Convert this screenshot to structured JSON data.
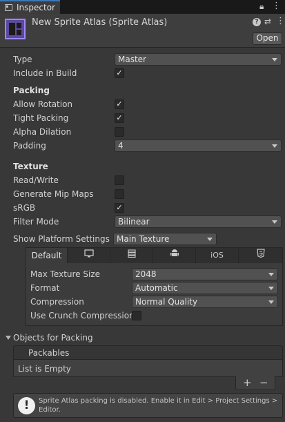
{
  "tab": {
    "title": "Inspector"
  },
  "header": {
    "title": "New Sprite Atlas (Sprite Atlas)",
    "open_label": "Open"
  },
  "type_row": {
    "label": "Type",
    "value": "Master"
  },
  "include_row": {
    "label": "Include in Build",
    "checked": true
  },
  "packing": {
    "heading": "Packing",
    "allow_rotation": {
      "label": "Allow Rotation",
      "checked": true
    },
    "tight_packing": {
      "label": "Tight Packing",
      "checked": true
    },
    "alpha_dilation": {
      "label": "Alpha Dilation",
      "checked": false
    },
    "padding": {
      "label": "Padding",
      "value": "4"
    }
  },
  "texture": {
    "heading": "Texture",
    "read_write": {
      "label": "Read/Write",
      "checked": false
    },
    "mip_maps": {
      "label": "Generate Mip Maps",
      "checked": false
    },
    "srgb": {
      "label": "sRGB",
      "checked": true
    },
    "filter_mode": {
      "label": "Filter Mode",
      "value": "Bilinear"
    }
  },
  "platform": {
    "label": "Show Platform Settings F",
    "value": "Main Texture",
    "tabs": [
      {
        "label": "Default",
        "icon": "default-tab"
      },
      {
        "label": "",
        "icon": "monitor-icon"
      },
      {
        "label": "",
        "icon": "server-icon"
      },
      {
        "label": "",
        "icon": "android-icon"
      },
      {
        "label": "iOS",
        "icon": "ios-tab"
      },
      {
        "label": "",
        "icon": "html5-icon"
      }
    ],
    "max_size": {
      "label": "Max Texture Size",
      "value": "2048"
    },
    "format": {
      "label": "Format",
      "value": "Automatic"
    },
    "compression": {
      "label": "Compression",
      "value": "Normal Quality"
    },
    "crunch": {
      "label": "Use Crunch Compression",
      "checked": false
    }
  },
  "objects": {
    "heading": "Objects for Packing",
    "list_header": "Packables",
    "empty_text": "List is Empty",
    "add_label": "+",
    "remove_label": "−"
  },
  "help": {
    "message": "Sprite Atlas packing is disabled. Enable it in Edit > Project Settings > Editor.",
    "icon": "exclamation-icon"
  },
  "colors": {
    "accent": "#3a79bb",
    "background": "#383838",
    "icon_purple": "#a085ff"
  }
}
